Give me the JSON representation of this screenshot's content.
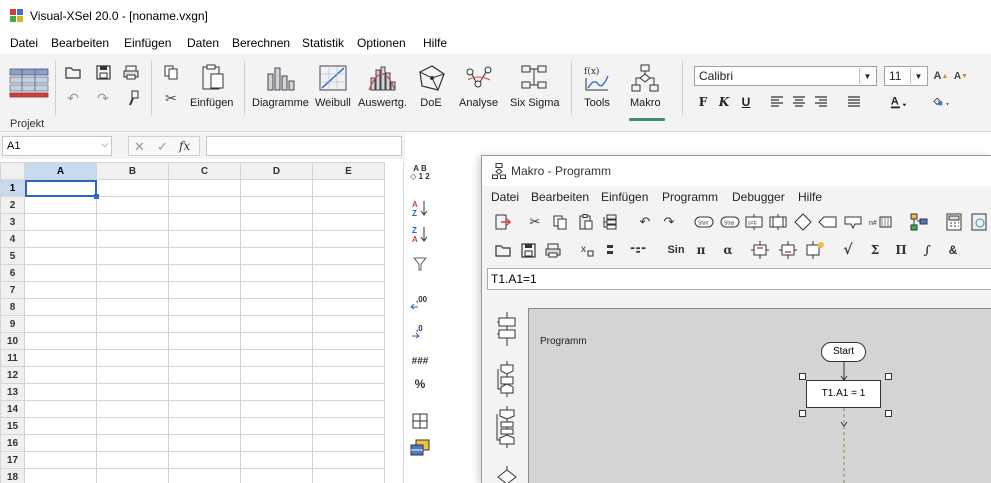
{
  "app": {
    "title": "Visual-XSel 20.0 - [noname.vxgn]"
  },
  "menu": [
    "Datei",
    "Bearbeiten",
    "Einfügen",
    "Daten",
    "Berechnen",
    "Statistik",
    "Optionen",
    "Hilfe"
  ],
  "ribbon": {
    "group_label": "Projekt",
    "buttons": {
      "einfuegen": "Einfügen",
      "diagramme": "Diagramme",
      "weibull": "Weibull",
      "auswertg": "Auswertg.",
      "doe": "DoE",
      "analyse": "Analyse",
      "six_sigma": "Six Sigma",
      "tools": "Tools",
      "makro": "Makro"
    },
    "font_name": "Calibri",
    "font_size": "11",
    "format": {
      "bold": "F",
      "italic": "K",
      "underline": "U"
    }
  },
  "formula_bar": {
    "cell_ref": "A1",
    "value": ""
  },
  "sheet": {
    "columns": [
      "A",
      "B",
      "C",
      "D",
      "E"
    ],
    "rows": [
      "1",
      "2",
      "3",
      "4",
      "5",
      "6",
      "7",
      "8",
      "9",
      "10",
      "11",
      "12",
      "13",
      "14",
      "15",
      "16",
      "17",
      "18"
    ],
    "selected": "A1"
  },
  "side_toolbar": {
    "sort_ab": "A B",
    "sort_12": "◇ 1 2",
    "hash": "###",
    "percent": "%"
  },
  "macro": {
    "title": "Makro - Programm",
    "menu": [
      "Datei",
      "Bearbeiten",
      "Einfügen",
      "Programm",
      "Debugger",
      "Hilfe"
    ],
    "toolbar_text": {
      "sin": "Sin",
      "pi": "π",
      "alpha": "α",
      "sqrt": "√",
      "sum": "Σ",
      "prod": "Π",
      "integral": "∫",
      "amp": "&"
    },
    "expression": "T1.A1=1",
    "canvas_label": "Programm",
    "flow": {
      "start": "Start",
      "step": "T1.A1 = 1"
    }
  },
  "colors": {
    "accent": "#3b8f7a",
    "selection": "#2a66c2",
    "header_selected": "#c8daf0",
    "canvas": "#d4d4d4"
  }
}
